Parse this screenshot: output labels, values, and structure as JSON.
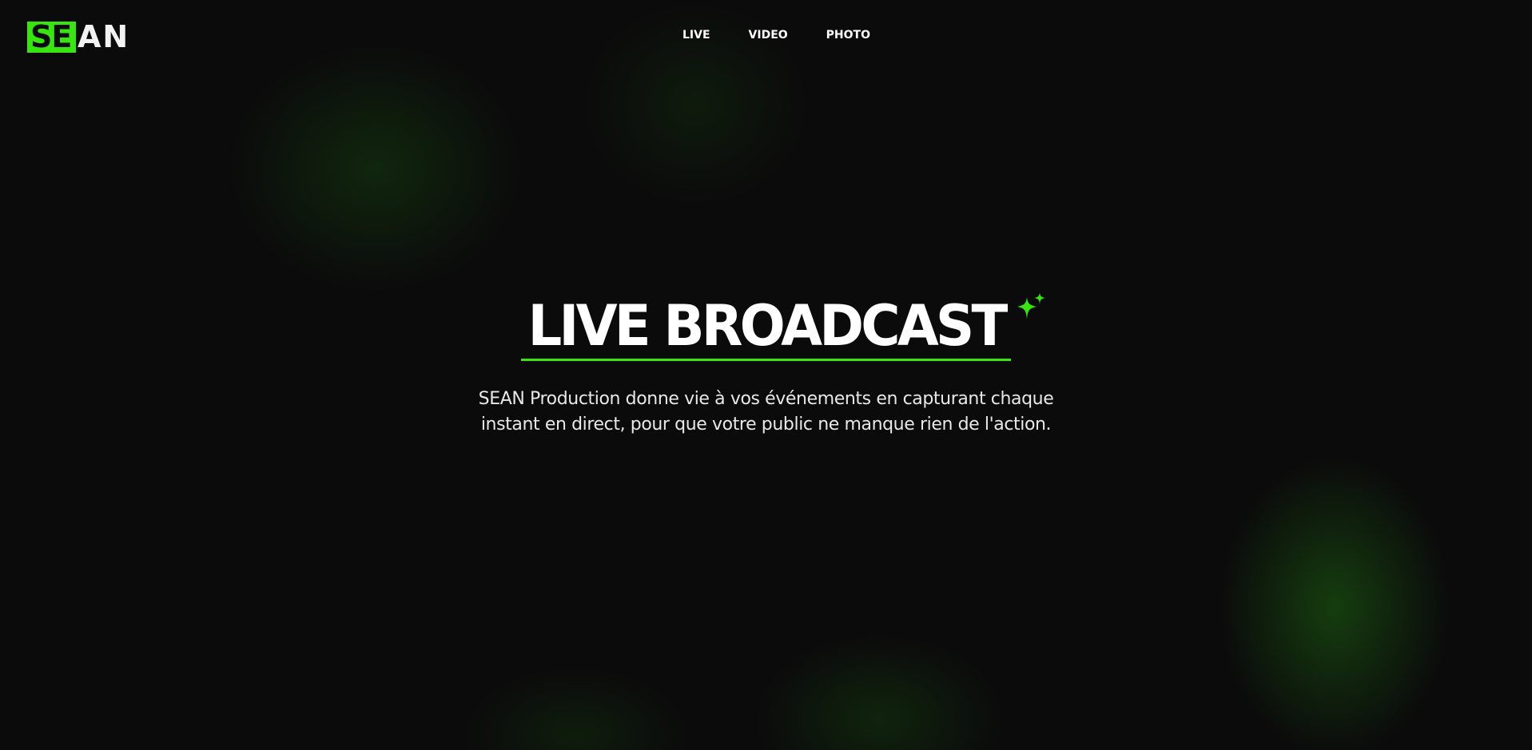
{
  "brand": {
    "logo_highlight": "SE",
    "logo_rest": "AN",
    "accent_color": "#37e60f"
  },
  "nav": {
    "items": [
      {
        "label": "LIVE"
      },
      {
        "label": "VIDEO"
      },
      {
        "label": "PHOTO"
      }
    ]
  },
  "hero": {
    "title": "LIVE BROADCAST",
    "title_icon": "sparkle-icon",
    "subtitle": "SEAN Production donne vie à vos événements en capturant chaque instant en direct, pour que votre public ne manque rien de l'action."
  }
}
